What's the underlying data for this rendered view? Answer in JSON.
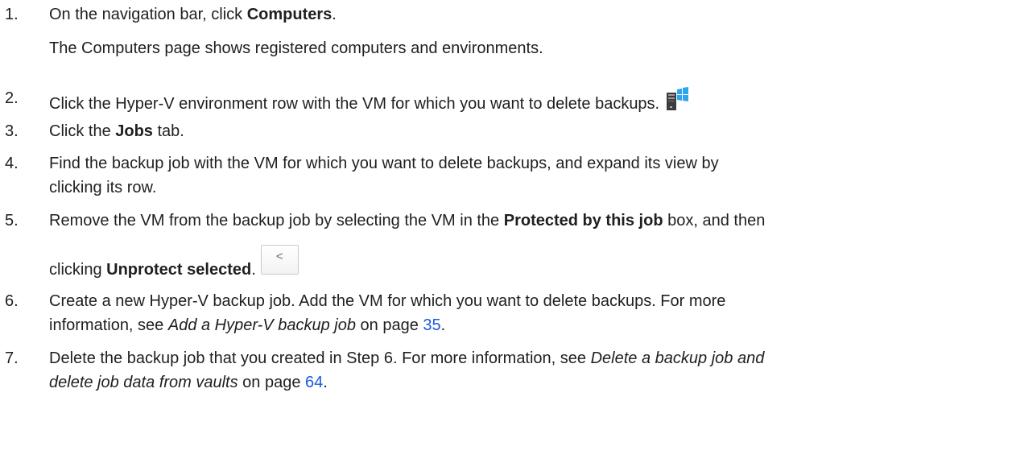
{
  "steps": [
    {
      "number": "1.",
      "pre": "On the navigation bar, click ",
      "bold": "Computers",
      "post": ".",
      "result": "The Computers page shows registered computers and environments."
    },
    {
      "number": "2.",
      "text": "Click the Hyper-V environment row with the VM for which you want to delete backups.",
      "icon": "windows-server-icon"
    },
    {
      "number": "3.",
      "pre": "Click the ",
      "bold": "Jobs",
      "post": " tab."
    },
    {
      "number": "4.",
      "line1": "Find the backup job with the VM for which you want to delete backups, and expand its view by",
      "line2": "clicking its row."
    },
    {
      "number": "5.",
      "pre": "Remove the VM from the backup job by selecting the VM in the ",
      "bold1": "Protected by this job",
      "mid": " box, and then",
      "pre2": "clicking ",
      "bold2": "Unprotect selected",
      "post2": ".",
      "button_glyph": "<",
      "icon": "chevron-left-icon"
    },
    {
      "number": "6.",
      "line1": "Create a new Hyper-V backup job. Add the VM for which you want to delete backups. For more",
      "pre2": "information, see ",
      "italic": "Add a Hyper-V backup job",
      "mid2": " on page ",
      "page": "35",
      "post2": "."
    },
    {
      "number": "7.",
      "pre1": "Delete the backup job that you created in Step 6. For more information, see ",
      "italic1": "Delete a backup job and",
      "italic2": "delete job data from vaults",
      "mid2": " on page ",
      "page": "64",
      "post2": "."
    }
  ],
  "colors": {
    "link": "#1a5adf",
    "text": "#1f1f1f"
  }
}
